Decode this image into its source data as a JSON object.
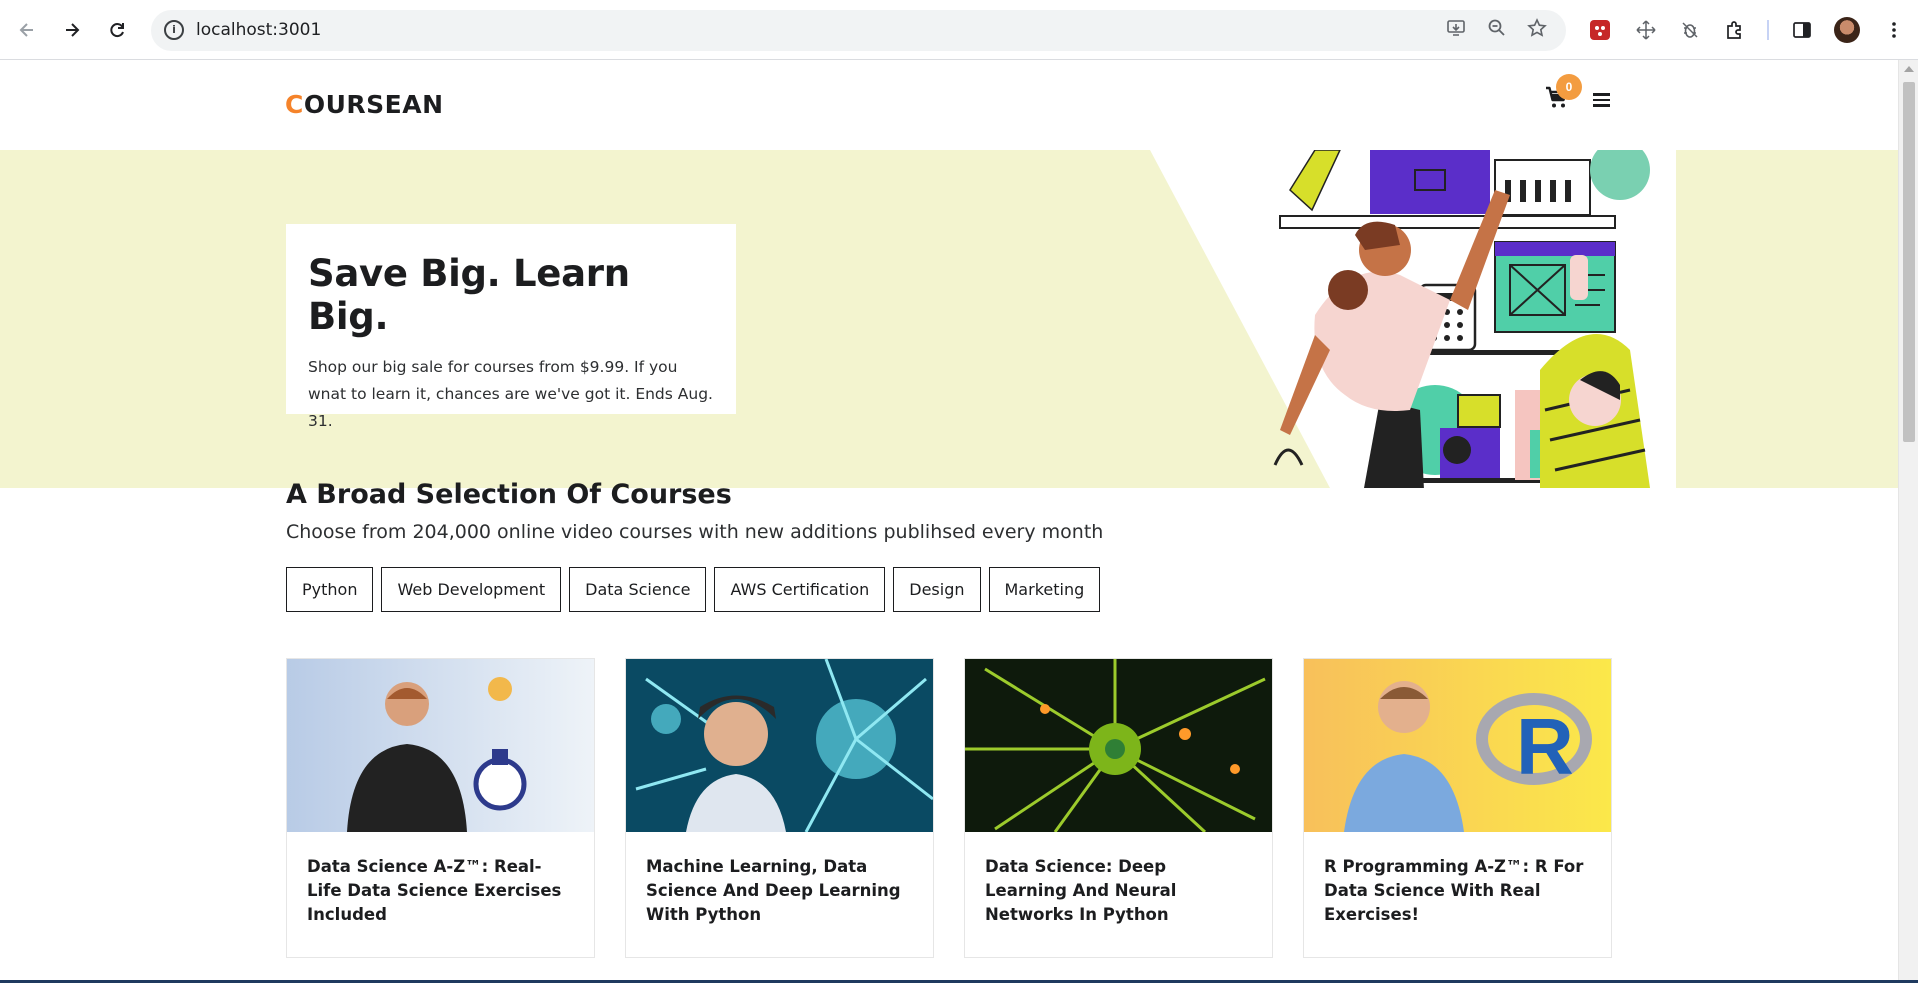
{
  "browser": {
    "url": "localhost:3001"
  },
  "header": {
    "logo_first": "C",
    "logo_rest": "OURSEAN",
    "cart_count": "0"
  },
  "hero": {
    "title": "Save Big. Learn Big.",
    "text": "Shop our big sale for courses from $9.99. If you wnat to learn it, chances are we've got it. Ends Aug. 31."
  },
  "courses_section": {
    "title": "A Broad Selection Of Courses",
    "subtitle": "Choose from 204,000 online video courses with new additions publihsed every month",
    "tags": [
      "Python",
      "Web Development",
      "Data Science",
      "AWS Certification",
      "Design",
      "Marketing"
    ]
  },
  "courses": [
    {
      "title": "Data Science A-Z™: Real-Life Data Science Exercises Included"
    },
    {
      "title": "Machine Learning, Data Science And Deep Learning With Python"
    },
    {
      "title": "Data Science: Deep Learning And Neural Networks In Python"
    },
    {
      "title": "R Programming A-Z™: R For Data Science With Real Exercises!"
    }
  ],
  "icons": {
    "back": "arrow-left-icon",
    "forward": "arrow-right-icon",
    "reload": "reload-icon",
    "cart": "cart-icon",
    "menu": "hamburger-icon"
  }
}
